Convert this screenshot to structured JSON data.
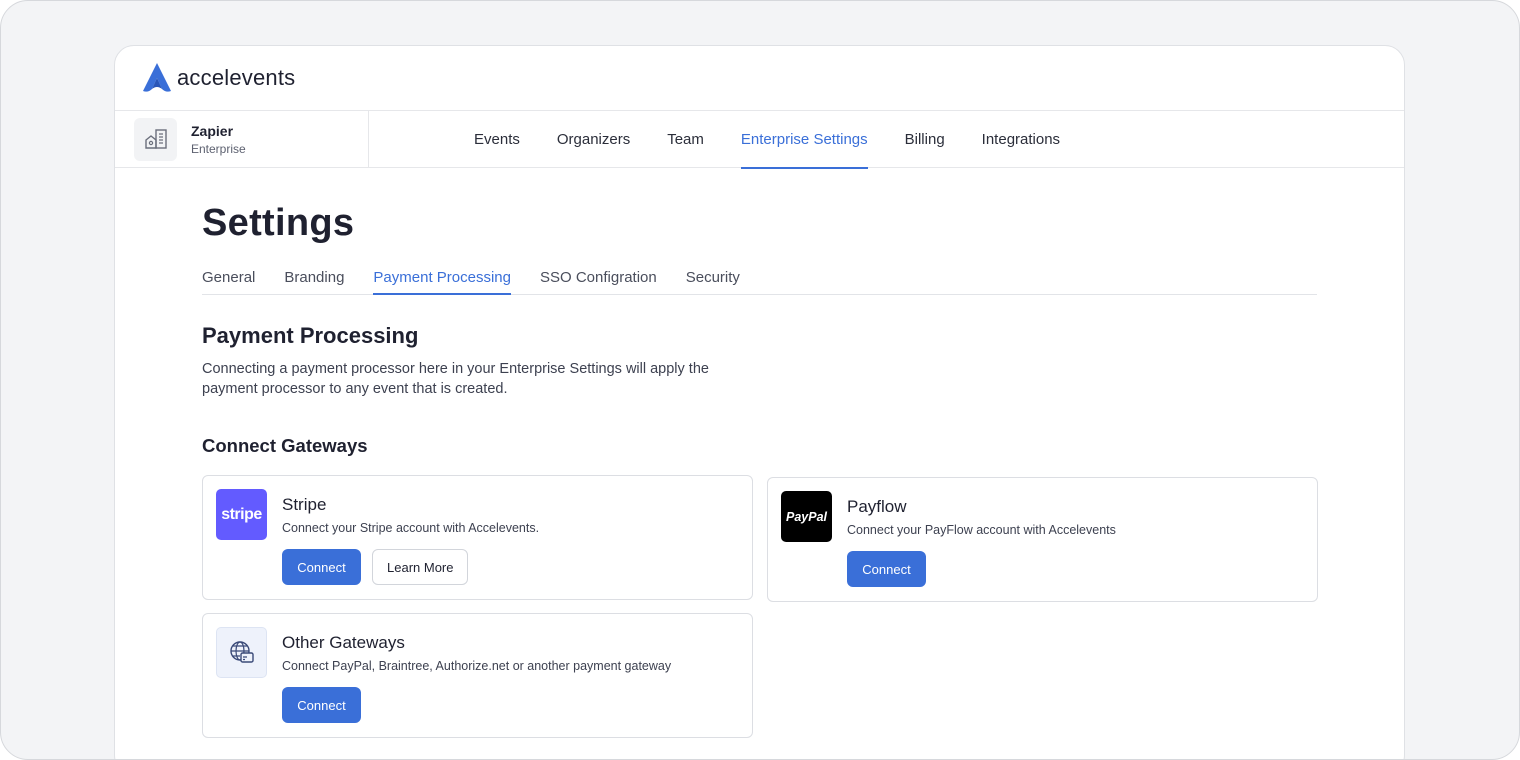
{
  "brand": {
    "name": "accelevents",
    "accent": "#3a6fd8"
  },
  "org": {
    "name": "Zapier",
    "plan": "Enterprise",
    "avatar_icon": "building-icon"
  },
  "main_nav": {
    "items": [
      {
        "label": "Events"
      },
      {
        "label": "Organizers"
      },
      {
        "label": "Team"
      },
      {
        "label": "Enterprise Settings",
        "active": true
      },
      {
        "label": "Billing"
      },
      {
        "label": "Integrations"
      }
    ]
  },
  "page": {
    "title": "Settings"
  },
  "sub_tabs": {
    "items": [
      {
        "label": "General"
      },
      {
        "label": "Branding"
      },
      {
        "label": "Payment Processing",
        "active": true
      },
      {
        "label": "SSO Configration"
      },
      {
        "label": "Security"
      }
    ]
  },
  "section": {
    "title": "Payment Processing",
    "description": "Connecting a payment processor here in your Enterprise Settings will apply the payment processor to any event that is created.",
    "gateways_title": "Connect Gateways"
  },
  "gateways": {
    "stripe": {
      "logo_text": "stripe",
      "logo_color": "#635bff",
      "title": "Stripe",
      "description": "Connect your Stripe account with Accelevents.",
      "connect_label": "Connect",
      "learn_more_label": "Learn More"
    },
    "payflow": {
      "logo_text": "PayPal",
      "logo_color": "#000000",
      "title": "Payflow",
      "description": "Connect your PayFlow account with Accelevents",
      "connect_label": "Connect"
    },
    "other": {
      "logo_icon": "globe-card-icon",
      "title": "Other Gateways",
      "description": "Connect PayPal, Braintree, Authorize.net or another payment gateway",
      "connect_label": "Connect"
    }
  }
}
